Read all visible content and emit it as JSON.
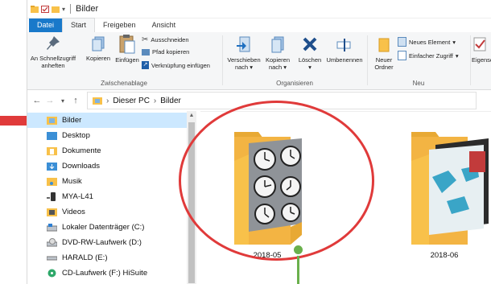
{
  "window": {
    "title": "Bilder"
  },
  "tabs": [
    {
      "label": "Datei"
    },
    {
      "label": "Start"
    },
    {
      "label": "Freigeben"
    },
    {
      "label": "Ansicht"
    }
  ],
  "ribbon": {
    "clipboard": {
      "pin_label": "An Schnellzugriff anheften",
      "copy_label": "Kopieren",
      "paste_label": "Einfügen",
      "cut_label": "Ausschneiden",
      "copy_path_label": "Pfad kopieren",
      "paste_shortcut_label": "Verknüpfung einfügen",
      "group_label": "Zwischenablage"
    },
    "organize": {
      "move_label": "Verschieben nach",
      "copy_to_label": "Kopieren nach",
      "delete_label": "Löschen",
      "rename_label": "Umbenennen",
      "group_label": "Organisieren"
    },
    "new": {
      "new_folder_label": "Neuer Ordner",
      "new_item_label": "Neues Element",
      "easy_access_label": "Einfacher Zugriff",
      "group_label": "Neu"
    },
    "open": {
      "properties_label": "Eigensch"
    }
  },
  "address": {
    "crumbs": [
      "Dieser PC",
      "Bilder"
    ]
  },
  "sidebar": {
    "items": [
      {
        "label": "Bilder",
        "selected": true
      },
      {
        "label": "Desktop"
      },
      {
        "label": "Dokumente"
      },
      {
        "label": "Downloads"
      },
      {
        "label": "Musik"
      },
      {
        "label": "MYA-L41"
      },
      {
        "label": "Videos"
      },
      {
        "label": "Lokaler Datenträger (C:)"
      },
      {
        "label": "DVD-RW-Laufwerk (D:)"
      },
      {
        "label": "HARALD (E:)"
      },
      {
        "label": "CD-Laufwerk (F:) HiSuite"
      }
    ]
  },
  "folders": [
    {
      "label": "2018-05"
    },
    {
      "label": "2018-06"
    }
  ],
  "colors": {
    "accent": "#1979ca",
    "selection": "#cce8ff",
    "folder": "#f8c14a",
    "annotation_red": "#e03a3a",
    "annotation_green": "#6ab04c"
  }
}
